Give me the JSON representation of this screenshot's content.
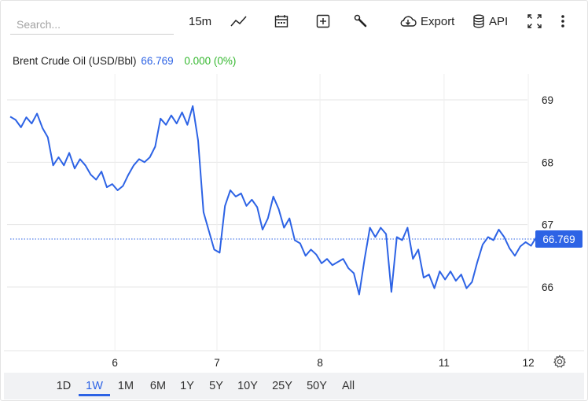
{
  "toolbar": {
    "search_placeholder": "Search...",
    "interval": "15m",
    "export_label": "Export",
    "api_label": "API"
  },
  "header": {
    "instrument": "Brent Crude Oil (USD/Bbl)",
    "price": "66.769",
    "change": "0.000 (0%)"
  },
  "range_buttons": [
    "1D",
    "1W",
    "1M",
    "6M",
    "1Y",
    "5Y",
    "10Y",
    "25Y",
    "50Y",
    "All"
  ],
  "active_range": "1W",
  "colors": {
    "line": "#2d63e5",
    "positive": "#35b82f",
    "grid": "#e6e6e6"
  },
  "chart_data": {
    "type": "line",
    "title": "",
    "xlabel": "",
    "ylabel": "",
    "ylim": [
      65.0,
      70.0
    ],
    "y_ticks": [
      66,
      67,
      68,
      69
    ],
    "x_ticks": [
      {
        "label": "6",
        "t": 0.195
      },
      {
        "label": "7",
        "t": 0.385
      },
      {
        "label": "8",
        "t": 0.577
      },
      {
        "label": "11",
        "t": 0.808
      },
      {
        "label": "12",
        "t": 0.965
      }
    ],
    "last_value": 66.769,
    "last_value_label": "66.769",
    "grid": true,
    "series": [
      {
        "name": "",
        "points": [
          [
            0.0,
            68.73
          ],
          [
            0.01,
            68.68
          ],
          [
            0.02,
            68.56
          ],
          [
            0.03,
            68.72
          ],
          [
            0.04,
            68.62
          ],
          [
            0.05,
            68.78
          ],
          [
            0.06,
            68.55
          ],
          [
            0.07,
            68.4
          ],
          [
            0.08,
            67.95
          ],
          [
            0.09,
            68.08
          ],
          [
            0.1,
            67.95
          ],
          [
            0.11,
            68.15
          ],
          [
            0.12,
            67.9
          ],
          [
            0.13,
            68.05
          ],
          [
            0.14,
            67.95
          ],
          [
            0.15,
            67.8
          ],
          [
            0.16,
            67.72
          ],
          [
            0.17,
            67.85
          ],
          [
            0.18,
            67.6
          ],
          [
            0.19,
            67.65
          ],
          [
            0.2,
            67.55
          ],
          [
            0.21,
            67.62
          ],
          [
            0.22,
            67.8
          ],
          [
            0.23,
            67.95
          ],
          [
            0.24,
            68.05
          ],
          [
            0.25,
            68.0
          ],
          [
            0.26,
            68.08
          ],
          [
            0.27,
            68.25
          ],
          [
            0.28,
            68.7
          ],
          [
            0.29,
            68.6
          ],
          [
            0.3,
            68.75
          ],
          [
            0.31,
            68.62
          ],
          [
            0.32,
            68.8
          ],
          [
            0.33,
            68.6
          ],
          [
            0.34,
            68.9
          ],
          [
            0.35,
            68.35
          ],
          [
            0.36,
            67.2
          ],
          [
            0.37,
            66.9
          ],
          [
            0.38,
            66.6
          ],
          [
            0.39,
            66.55
          ],
          [
            0.4,
            67.3
          ],
          [
            0.41,
            67.55
          ],
          [
            0.42,
            67.45
          ],
          [
            0.43,
            67.5
          ],
          [
            0.44,
            67.3
          ],
          [
            0.45,
            67.4
          ],
          [
            0.46,
            67.28
          ],
          [
            0.47,
            66.92
          ],
          [
            0.48,
            67.1
          ],
          [
            0.49,
            67.45
          ],
          [
            0.5,
            67.25
          ],
          [
            0.51,
            66.95
          ],
          [
            0.52,
            67.1
          ],
          [
            0.53,
            66.75
          ],
          [
            0.54,
            66.7
          ],
          [
            0.55,
            66.5
          ],
          [
            0.56,
            66.6
          ],
          [
            0.57,
            66.52
          ],
          [
            0.58,
            66.38
          ],
          [
            0.59,
            66.45
          ],
          [
            0.6,
            66.35
          ],
          [
            0.61,
            66.4
          ],
          [
            0.62,
            66.45
          ],
          [
            0.63,
            66.3
          ],
          [
            0.64,
            66.22
          ],
          [
            0.65,
            65.88
          ],
          [
            0.66,
            66.45
          ],
          [
            0.67,
            66.95
          ],
          [
            0.68,
            66.8
          ],
          [
            0.69,
            66.95
          ],
          [
            0.7,
            66.85
          ],
          [
            0.71,
            65.92
          ],
          [
            0.72,
            66.8
          ],
          [
            0.73,
            66.75
          ],
          [
            0.74,
            66.95
          ],
          [
            0.75,
            66.45
          ],
          [
            0.76,
            66.6
          ],
          [
            0.77,
            66.15
          ],
          [
            0.78,
            66.2
          ],
          [
            0.79,
            65.98
          ],
          [
            0.8,
            66.25
          ],
          [
            0.81,
            66.12
          ],
          [
            0.82,
            66.25
          ],
          [
            0.83,
            66.1
          ],
          [
            0.84,
            66.2
          ],
          [
            0.85,
            65.98
          ],
          [
            0.86,
            66.08
          ],
          [
            0.87,
            66.4
          ],
          [
            0.88,
            66.68
          ],
          [
            0.89,
            66.8
          ],
          [
            0.9,
            66.75
          ],
          [
            0.91,
            66.92
          ],
          [
            0.92,
            66.8
          ],
          [
            0.93,
            66.62
          ],
          [
            0.94,
            66.5
          ],
          [
            0.95,
            66.65
          ],
          [
            0.96,
            66.72
          ],
          [
            0.97,
            66.66
          ],
          [
            0.98,
            66.8
          ],
          [
            0.99,
            66.74
          ],
          [
            1.0,
            66.78
          ]
        ]
      }
    ]
  }
}
